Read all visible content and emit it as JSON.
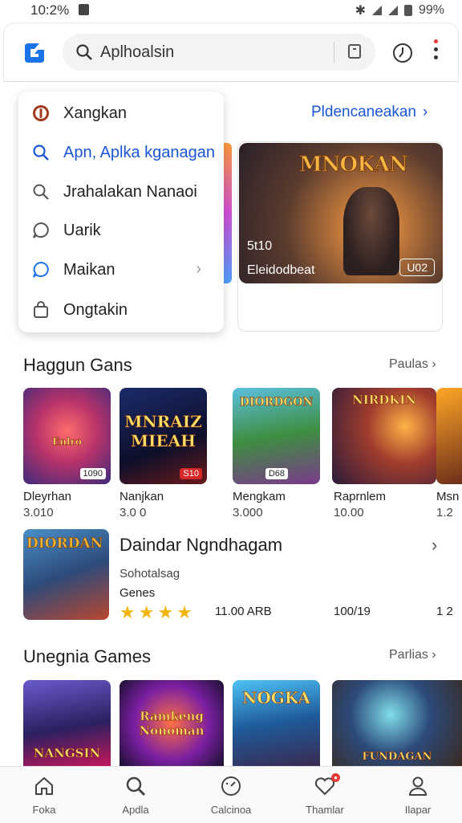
{
  "status_bar": {
    "time": "10:2%",
    "battery": "99%"
  },
  "search": {
    "query": "Aplhoalsin"
  },
  "menu": {
    "items": [
      {
        "label": "Xangkan",
        "icon": "circle-badge-icon"
      },
      {
        "label": "Apn, Aplka kganagan",
        "icon": "search-icon"
      },
      {
        "label": "Jrahalakan  Nanaoi",
        "icon": "search-icon"
      },
      {
        "label": "Uarik",
        "icon": "chat-bubble-icon"
      },
      {
        "label": "Maikan",
        "icon": "chat-bubble-icon"
      },
      {
        "label": "Ongtakin",
        "icon": "bag-icon"
      }
    ]
  },
  "featured_link": {
    "label": "Pldencaneakan"
  },
  "hero": {
    "title": "MNOKAN",
    "number": "5t10",
    "subtitle": "Eleidodbeat",
    "badge": "U02"
  },
  "section1": {
    "title": "Haggun Gans",
    "see_more": "Paulas",
    "tiles": [
      {
        "name": "Dleyrhan",
        "sub": "3.010",
        "art": "Enlro",
        "badge": "1090"
      },
      {
        "name": "Nanjkan",
        "sub": "3.0 0",
        "art": "MNRAIZ MIEAH",
        "badge": "S10"
      },
      {
        "name": "Mengkam",
        "sub": "3.000",
        "art": "DIORDGON",
        "badge": "D68"
      },
      {
        "name": "Raprnlem",
        "sub": "10.00",
        "art": "NIRDKIN",
        "badge": ""
      },
      {
        "name": "Msn",
        "sub": "1.2",
        "art": "",
        "badge": ""
      }
    ]
  },
  "featured_app": {
    "title": "Daindar Ngndhagam",
    "art": "DIORDAN",
    "subtitle": "Sohotalsag",
    "category": "Genes",
    "rating": 4,
    "price": "11.00 ARB",
    "count": "100/19",
    "extra": "1 2"
  },
  "section2": {
    "title": "Unegnia Games",
    "see_more": "Parlias",
    "tiles": [
      {
        "art": "NANGSIN"
      },
      {
        "art": "Ramkeng Nonoman"
      },
      {
        "art": "NOGKA"
      },
      {
        "art": "FUNDAGAN"
      }
    ]
  },
  "bottom_nav": [
    {
      "label": "Foka",
      "icon": "home-icon"
    },
    {
      "label": "Apdla",
      "icon": "search-icon"
    },
    {
      "label": "Calcinoa",
      "icon": "gauge-icon"
    },
    {
      "label": "Thamlar",
      "icon": "heart-icon"
    },
    {
      "label": "Ilapar",
      "icon": "person-icon"
    }
  ],
  "colors": {
    "accent": "#1a56d6",
    "star": "#f2b40f",
    "notification": "#e53935"
  }
}
